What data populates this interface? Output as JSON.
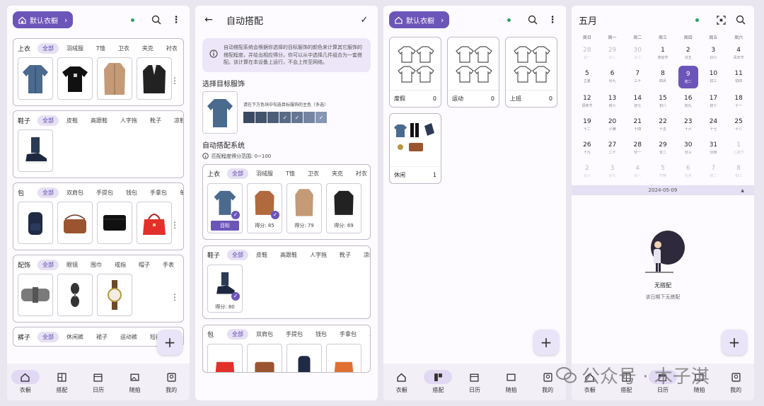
{
  "wardrobe": {
    "chip_label": "默认衣橱",
    "categories": [
      {
        "name": "上衣",
        "filters": [
          "全部",
          "羽绒服",
          "T恤",
          "卫衣",
          "夹克",
          "衬衣"
        ]
      },
      {
        "name": "鞋子",
        "filters": [
          "全部",
          "皮鞋",
          "高跟鞋",
          "人字拖",
          "靴子",
          "凉鞋"
        ]
      },
      {
        "name": "包",
        "filters": [
          "全部",
          "双肩包",
          "手提包",
          "钱包",
          "手拿包",
          "单肩"
        ]
      },
      {
        "name": "配饰",
        "filters": [
          "全部",
          "眼镜",
          "围巾",
          "戒指",
          "帽子",
          "手表"
        ]
      },
      {
        "name": "裤子",
        "filters": [
          "全部",
          "休闲裤",
          "裙子",
          "运动裤",
          "短裤"
        ]
      }
    ]
  },
  "auto": {
    "title": "自动搭配",
    "info": "自动搭配系统会根据你选择的目标服饰的颜色来计算其它服饰的搭配程度，并给出相应得分，你可以从中选择几件组合为一套搭配。该计算在本设备上运行，不会上传至网络。",
    "select_title": "选择目标服饰",
    "color_hint": "请在下方色块中勾选目标服饰的主色（多选）",
    "system_title": "自动搭配系统",
    "range_note": "匹配程度得分范围: 0~100",
    "target_label": "目标",
    "tops": {
      "name": "上衣",
      "filters": [
        "全部",
        "羽绒服",
        "T恤",
        "卫衣",
        "夹克",
        "衬衣"
      ],
      "scores": [
        "得分: 85",
        "得分: 79",
        "得分: 69"
      ]
    },
    "shoes": {
      "name": "鞋子",
      "filters": [
        "全部",
        "皮鞋",
        "高跟鞋",
        "人字拖",
        "靴子",
        "凉鞋"
      ],
      "score": "得分: 80"
    },
    "bags": {
      "name": "包",
      "filters": [
        "全部",
        "双肩包",
        "手提包",
        "钱包",
        "手拿包",
        "单肩"
      ]
    },
    "swatches": [
      "#3b4a62",
      "#43536c",
      "#4d5d78",
      "#586a86",
      "#647793",
      "#7385a1",
      "#8596b2"
    ]
  },
  "outfits": {
    "items": [
      {
        "name": "度假",
        "count": "0"
      },
      {
        "name": "运动",
        "count": "0"
      },
      {
        "name": "上班",
        "count": "0"
      },
      {
        "name": "休闲",
        "count": "1"
      }
    ]
  },
  "calendar": {
    "month": "五月",
    "weekdays": [
      "周日",
      "周一",
      "周二",
      "周三",
      "周四",
      "周五",
      "周六"
    ],
    "days": [
      {
        "d": "28",
        "s": "廿一",
        "o": true
      },
      {
        "d": "29",
        "s": "廿二",
        "o": true
      },
      {
        "d": "30",
        "s": "廿三",
        "o": true
      },
      {
        "d": "1",
        "s": "劳动节"
      },
      {
        "d": "2",
        "s": "廿五"
      },
      {
        "d": "3",
        "s": "廿六"
      },
      {
        "d": "4",
        "s": "青年节"
      },
      {
        "d": "5",
        "s": "立夏"
      },
      {
        "d": "6",
        "s": "廿九"
      },
      {
        "d": "7",
        "s": "三十"
      },
      {
        "d": "8",
        "s": "四月"
      },
      {
        "d": "9",
        "s": "初二",
        "t": true
      },
      {
        "d": "10",
        "s": "初三"
      },
      {
        "d": "11",
        "s": "初四"
      },
      {
        "d": "12",
        "s": "母亲节"
      },
      {
        "d": "13",
        "s": "初六"
      },
      {
        "d": "14",
        "s": "初七"
      },
      {
        "d": "15",
        "s": "初八"
      },
      {
        "d": "16",
        "s": "初九"
      },
      {
        "d": "17",
        "s": "初十"
      },
      {
        "d": "18",
        "s": "十一"
      },
      {
        "d": "19",
        "s": "十二"
      },
      {
        "d": "20",
        "s": "小满"
      },
      {
        "d": "21",
        "s": "十四"
      },
      {
        "d": "22",
        "s": "十五"
      },
      {
        "d": "23",
        "s": "十六"
      },
      {
        "d": "24",
        "s": "十七"
      },
      {
        "d": "25",
        "s": "十八"
      },
      {
        "d": "26",
        "s": "十九"
      },
      {
        "d": "27",
        "s": "二十"
      },
      {
        "d": "28",
        "s": "廿一"
      },
      {
        "d": "29",
        "s": "廿二"
      },
      {
        "d": "30",
        "s": "廿三"
      },
      {
        "d": "31",
        "s": "廿四"
      },
      {
        "d": "1",
        "s": "儿童节",
        "o": true
      },
      {
        "d": "2",
        "s": "廿六",
        "o": true
      },
      {
        "d": "3",
        "s": "廿七",
        "o": true
      },
      {
        "d": "4",
        "s": "廿八",
        "o": true
      },
      {
        "d": "5",
        "s": "芒种",
        "o": true
      },
      {
        "d": "6",
        "s": "五月",
        "o": true
      },
      {
        "d": "7",
        "s": "初二",
        "o": true
      },
      {
        "d": "8",
        "s": "初三",
        "o": true
      }
    ],
    "selected_date": "2024-05-09",
    "empty_title": "无搭配",
    "empty_sub": "该日期下无搭配"
  },
  "nav": {
    "items": [
      "衣橱",
      "搭配",
      "日历",
      "随拍",
      "我的"
    ]
  },
  "watermark": {
    "text": "公众号 · 木子淇"
  },
  "colors": {
    "accent": "#6c55b8",
    "accent_light": "#e6e0f4",
    "online": "#2ea063"
  }
}
